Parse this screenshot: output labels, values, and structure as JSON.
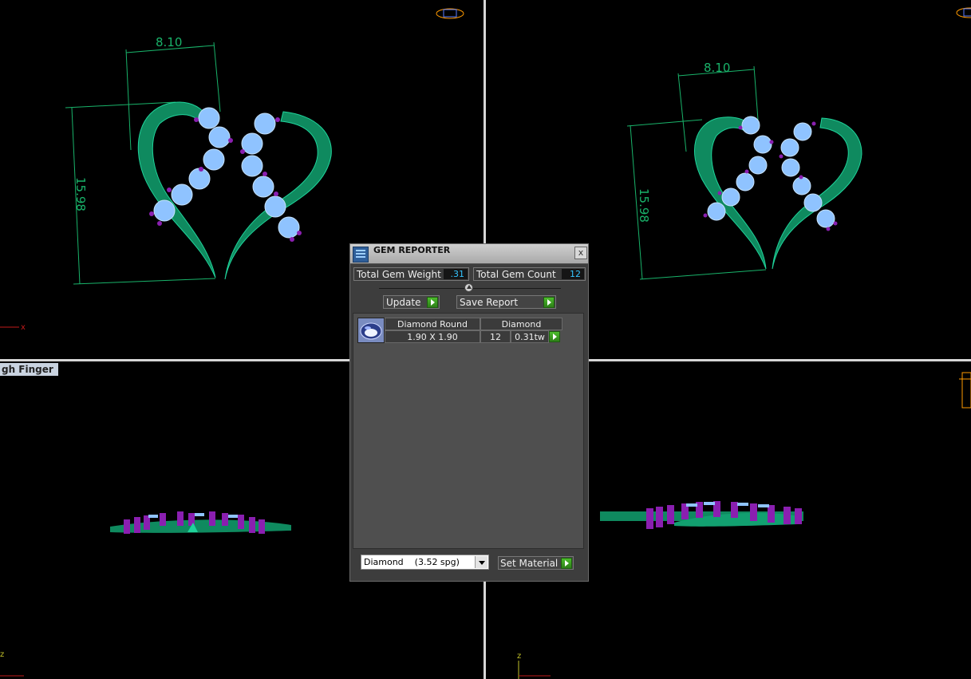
{
  "viewports": {
    "top_left": {
      "dimension_width": "8.10",
      "dimension_height": "15.98",
      "axis_x": "x"
    },
    "top_right": {
      "dimension_width": "8.10",
      "dimension_height": "15.98"
    },
    "bottom_left": {
      "label": "gh Finger",
      "axis_z": "z"
    },
    "bottom_right": {
      "axis_z": "z"
    }
  },
  "gem_reporter": {
    "title": "GEM REPORTER",
    "close_label": "x",
    "total_weight_label": "Total Gem Weight",
    "total_weight_value": ".31",
    "total_count_label": "Total Gem Count",
    "total_count_value": "12",
    "update_label": "Update",
    "save_report_label": "Save Report",
    "gems": [
      {
        "shape": "Diamond Round",
        "size": "1.90 X 1.90",
        "material": "Diamond",
        "count": "12",
        "weight": "0.31tw",
        "thumbnail_icon": "round-gem-icon"
      }
    ],
    "material_select": {
      "value": "Diamond    (3.52 spg)"
    },
    "set_material_label": "Set Material"
  },
  "colors": {
    "metal": "#0f8a5f",
    "gem": "#8fc3ff",
    "prong": "#8a1fb0",
    "dimension": "#19b36a",
    "dialog_bg": "#3d3d3d",
    "value_text": "#35c5ff",
    "go_button": "#3aa020"
  }
}
